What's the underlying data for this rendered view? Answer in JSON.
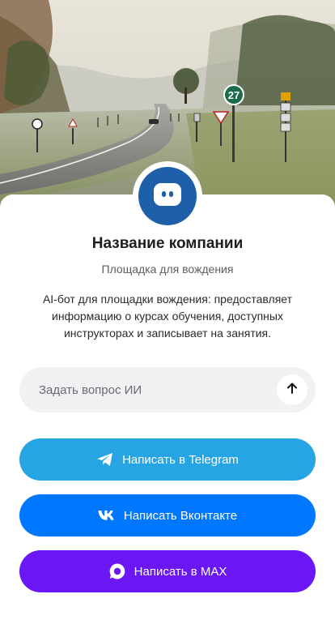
{
  "company": {
    "name": "Название компании",
    "subtitle": "Площадка для вождения",
    "description": "AI-бот для площадки вождения: предоставляет информацию о курсах обучения, доступных инструкторах и записывает на занятия.",
    "avatar_color": "#1d5fa8"
  },
  "hero": {
    "road_sign_number": "27"
  },
  "ask": {
    "placeholder": "Задать вопрос ИИ",
    "value": "",
    "send_icon": "arrow-up-icon"
  },
  "actions": [
    {
      "label": "Написать в Telegram",
      "icon": "telegram-icon",
      "color": "#27a4e3"
    },
    {
      "label": "Написать Вконтакте",
      "icon": "vk-icon",
      "color": "#0077ff"
    },
    {
      "label": "Написать в MAX",
      "icon": "max-icon",
      "color": "#6b16f5"
    }
  ]
}
